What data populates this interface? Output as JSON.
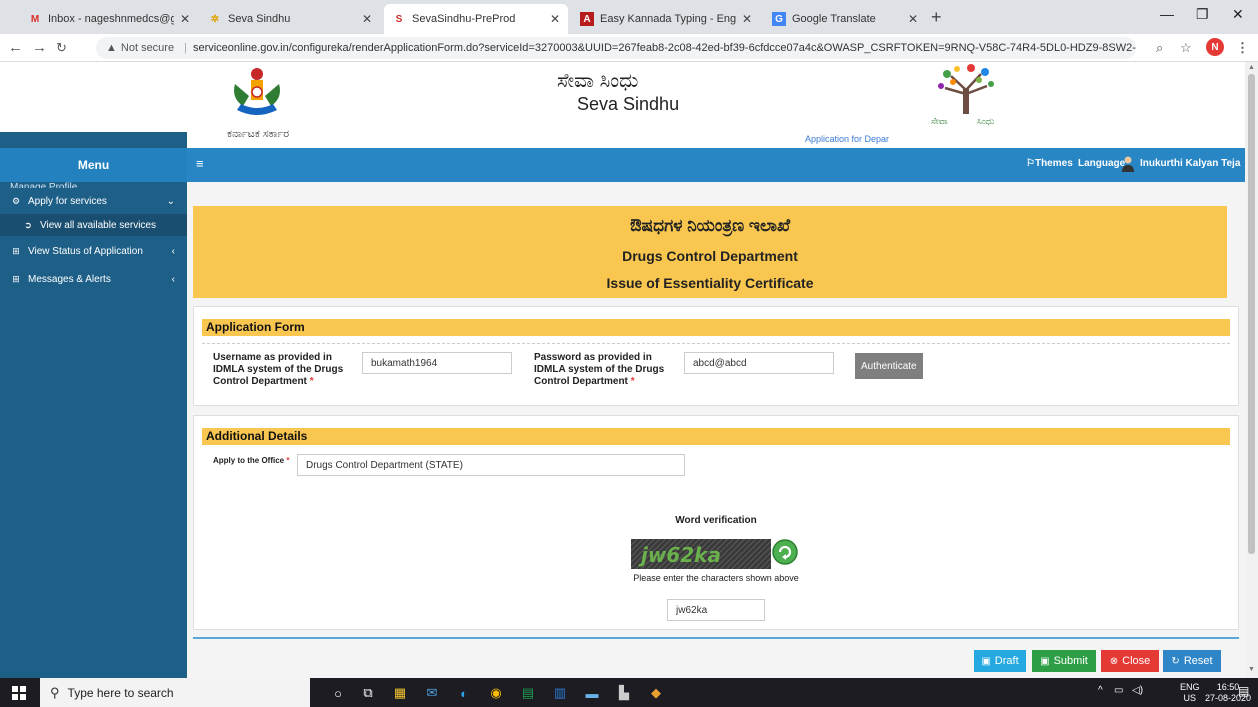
{
  "browser": {
    "tabs": [
      {
        "title": "Inbox - nageshnmedcs@gmail.co",
        "icon": "gmail-icon"
      },
      {
        "title": "Seva Sindhu",
        "icon": "seva-sindhu-icon"
      },
      {
        "title": "SevaSindhu-PreProd",
        "icon": "seva-sindhu-icon",
        "active": true
      },
      {
        "title": "Easy Kannada Typing - English to",
        "icon": "kannada-typing-icon"
      },
      {
        "title": "Google Translate",
        "icon": "google-translate-icon"
      }
    ],
    "not_secure": "Not secure",
    "url": "serviceonline.gov.in/configureka/renderApplicationForm.do?serviceId=3270003&UUID=267feab8-2c08-42ed-bf39-6cfdcce07a4c&OWASP_CSRFTOKEN=9RNQ-V58C-74R4-5DL0-HDZ9-8SW2-S9AC...",
    "profile_initial": "N"
  },
  "header": {
    "emblem_caption": "ಕರ್ನಾಟಕ ಸರ್ಕಾರ",
    "site_name_kn": "ಸೇವಾ ಸಿಂಧು",
    "site_name_en": "Seva Sindhu",
    "application_for": "Application for Depar"
  },
  "menubar": {
    "menu_label": "Menu",
    "themes": "Themes",
    "language": "Language",
    "user_name": "Inukurthi Kalyan Teja"
  },
  "sidebar": {
    "cut_item": "Manage Profile",
    "items": [
      {
        "label": "Apply for services"
      },
      {
        "label": "View all available services"
      },
      {
        "label": "View Status of Application"
      },
      {
        "label": "Messages & Alerts"
      }
    ]
  },
  "banner": {
    "dept_kn": "ಔಷಧಗಳ ನಿಯಂತ್ರಣ ಇಲಾಖೆ",
    "dept_en": "Drugs Control Department",
    "service": "Issue of Essentiality Certificate"
  },
  "application_form": {
    "heading": "Application Form",
    "username_label": "Username as provided in IDMLA system of the Drugs Control Department",
    "username_value": "bukamath1964",
    "password_label": "Password as provided in IDMLA system of the Drugs Control Department",
    "password_value": "abcd@abcd",
    "authenticate": "Authenticate"
  },
  "additional_details": {
    "heading": "Additional Details",
    "office_label": "Apply to the Office",
    "office_value": "Drugs Control Department (STATE)"
  },
  "word_verification": {
    "title": "Word verification",
    "captcha_text": "jw62ka",
    "hint": "Please enter the characters shown above",
    "input_value": "jw62ka"
  },
  "actions": {
    "draft": "Draft",
    "submit": "Submit",
    "close": "Close",
    "reset": "Reset"
  },
  "colors": {
    "menubar_blue": "#2886c5",
    "sidebar_navy": "#1e5f88",
    "banner_yellow": "#f9c74f",
    "draft": "#26a9e0",
    "submit": "#2e9e46",
    "close": "#e53935",
    "reset": "#2e86c9"
  },
  "taskbar": {
    "search_placeholder": "Type here to search",
    "lang_top": "ENG",
    "lang_bottom": "US",
    "time": "16:50",
    "date": "27-08-2020"
  }
}
